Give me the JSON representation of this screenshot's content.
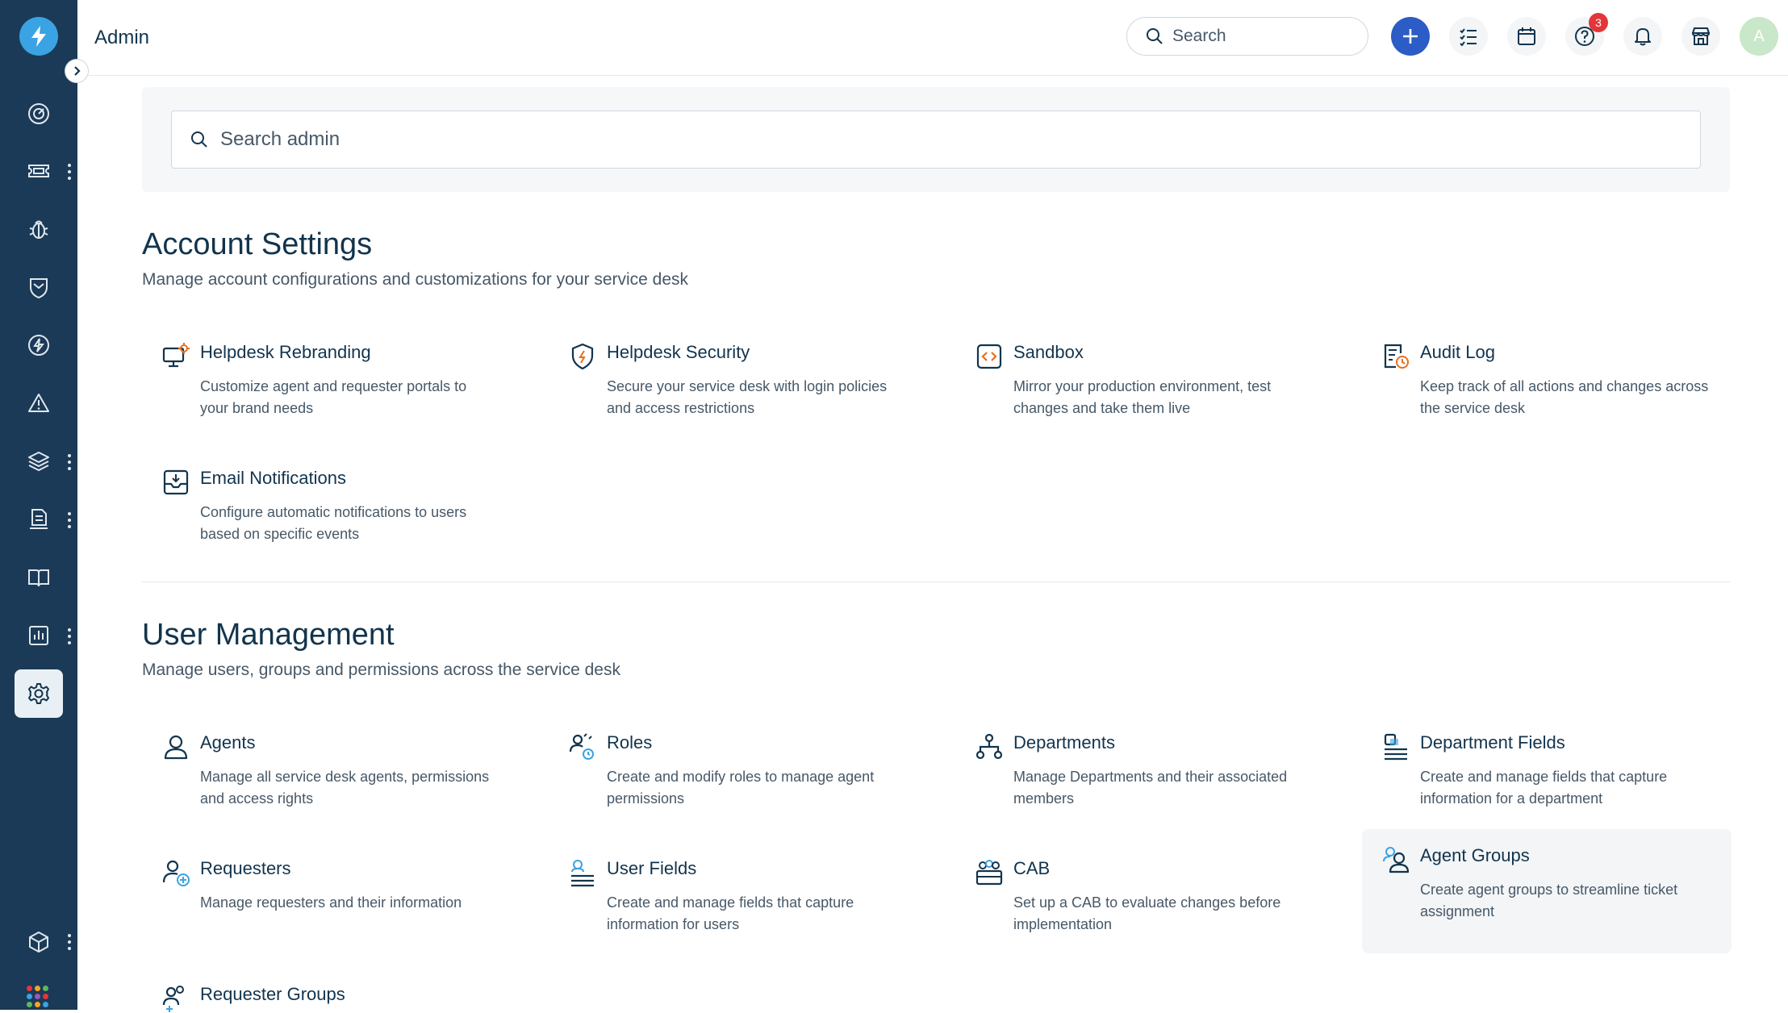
{
  "header": {
    "title": "Admin",
    "search_placeholder": "Search",
    "help_badge": "3",
    "avatar_initial": "A"
  },
  "admin_search": {
    "placeholder": "Search admin"
  },
  "account_settings": {
    "title": "Account Settings",
    "description": "Manage account configurations and customizations for your service desk",
    "items": [
      {
        "title": "Helpdesk Rebranding",
        "desc": "Customize agent and requester portals to your brand needs",
        "icon": "rebranding-icon"
      },
      {
        "title": "Helpdesk Security",
        "desc": "Secure your service desk with login policies and access restrictions",
        "icon": "shield-icon"
      },
      {
        "title": "Sandbox",
        "desc": "Mirror your production environment, test changes and take them live",
        "icon": "sandbox-icon"
      },
      {
        "title": "Audit Log",
        "desc": "Keep track of all actions and changes across the service desk",
        "icon": "audit-log-icon"
      },
      {
        "title": "Email Notifications",
        "desc": "Configure automatic notifications to users based on specific events",
        "icon": "inbox-icon"
      }
    ]
  },
  "user_management": {
    "title": "User Management",
    "description": "Manage users, groups and permissions across the service desk",
    "items": [
      {
        "title": "Agents",
        "desc": "Manage all service desk agents, permissions and access rights",
        "icon": "agent-icon"
      },
      {
        "title": "Roles",
        "desc": "Create and modify roles to manage agent permissions",
        "icon": "roles-icon"
      },
      {
        "title": "Departments",
        "desc": "Manage Departments and their associated members",
        "icon": "departments-icon"
      },
      {
        "title": "Department Fields",
        "desc": "Create and manage fields that capture information for a department",
        "icon": "department-fields-icon"
      },
      {
        "title": "Requesters",
        "desc": "Manage requesters and their information",
        "icon": "requester-icon"
      },
      {
        "title": "User Fields",
        "desc": "Create and manage fields that capture information for users",
        "icon": "user-fields-icon"
      },
      {
        "title": "CAB",
        "desc": "Set up a CAB to evaluate changes before implementation",
        "icon": "cab-icon"
      },
      {
        "title": "Agent Groups",
        "desc": "Create agent groups to streamline ticket assignment",
        "icon": "agent-groups-icon"
      },
      {
        "title": "Requester Groups",
        "desc": "",
        "icon": "requester-groups-icon"
      }
    ]
  },
  "colors": {
    "sidebar": "#1b3a57",
    "accent": "#2c5cc5",
    "logo": "#3aa3e3",
    "badge": "#e43538",
    "icon_accent": "#e86f1c"
  }
}
